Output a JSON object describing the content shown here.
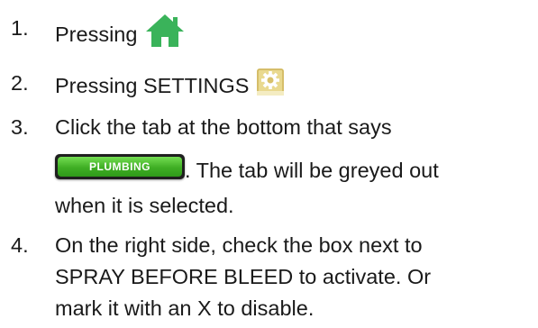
{
  "steps": [
    {
      "num": "1.",
      "text": "Pressing",
      "icon": "home-icon"
    },
    {
      "num": "2.",
      "text": "Pressing SETTINGS",
      "icon": "settings-icon"
    },
    {
      "num": "3.",
      "line1": "Click the tab at the bottom that says",
      "button_label": "PLUMBING",
      "line2_after": ". The tab will be greyed out",
      "line3": "when it is selected."
    },
    {
      "num": "4.",
      "line1": "On the right side, check the box next to",
      "line2": "SPRAY BEFORE BLEED to activate. Or",
      "line3": "mark it with an X to disable."
    }
  ],
  "colors": {
    "home_icon": "#3ab35a",
    "settings_icon": "#e9d98f",
    "plumbing_button": "#3fae24",
    "text": "#1a1a1a"
  }
}
